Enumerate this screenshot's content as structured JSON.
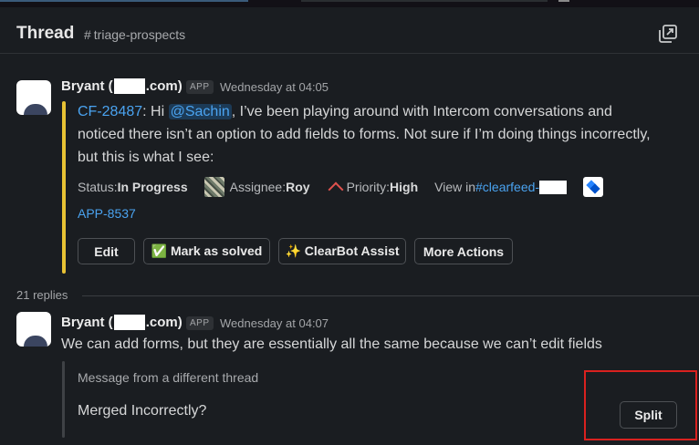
{
  "header": {
    "title": "Thread",
    "channel": "triage-prospects"
  },
  "message1": {
    "sender_prefix": "Bryant (",
    "sender_suffix": ".com)",
    "badge": "APP",
    "time": "Wednesday at 04:05",
    "ticket_id": "CF-28487",
    "greeting": ":  Hi ",
    "mention": "@Sachin",
    "body": ", I’ve been playing around with Intercom conversations and noticed there isn’t an option to add fields to forms. Not sure if I’m doing things incorrectly, but this is what I see:",
    "status_label": "Status: ",
    "status_value": "In Progress",
    "assignee_label": "Assignee: ",
    "assignee_value": "Roy",
    "priority_label": "Priority: ",
    "priority_value": "High",
    "view_in_label": "View in ",
    "view_in_channel": "#clearfeed-",
    "jira_link": "APP-8537",
    "buttons": {
      "edit": "Edit",
      "mark_solved": "✅ Mark as solved",
      "clearbot": "✨ ClearBot Assist",
      "more": "More Actions"
    }
  },
  "replies_count": "21 replies",
  "message2": {
    "sender_prefix": "Bryant (",
    "sender_suffix": ".com)",
    "badge": "APP",
    "time": "Wednesday at 04:07",
    "body": "We can add forms, but they are essentially all the same because we can’t edit fields",
    "thread_note": "Message from a different thread",
    "merged_question": "Merged Incorrectly?",
    "split_label": "Split"
  },
  "colors": {
    "accent_link": "#4aa3f0",
    "quote_bar": "#e8c234",
    "highlight": "#d9211f",
    "background": "#1a1d21"
  },
  "icons": [
    "popout-icon",
    "assignee-avatar-icon",
    "priority-up-icon",
    "jira-icon"
  ]
}
